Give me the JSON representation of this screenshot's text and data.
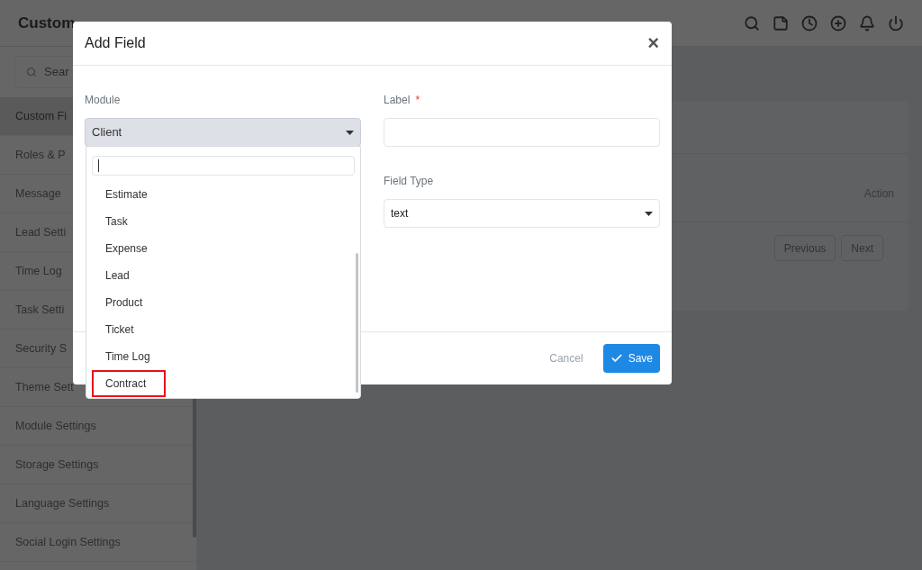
{
  "header": {
    "title": "Custom"
  },
  "sidebar": {
    "search": {
      "placeholder": "Sear"
    },
    "items": [
      {
        "label": "Custom Fi",
        "selected": true
      },
      {
        "label": "Roles & P",
        "selected": false
      },
      {
        "label": "Message",
        "selected": false
      },
      {
        "label": "Lead Setti",
        "selected": false
      },
      {
        "label": "Time Log",
        "selected": false
      },
      {
        "label": "Task Setti",
        "selected": false
      },
      {
        "label": "Security S",
        "selected": false
      },
      {
        "label": "Theme Sett",
        "selected": false
      },
      {
        "label": "Module Settings",
        "selected": false
      },
      {
        "label": "Storage Settings",
        "selected": false
      },
      {
        "label": "Language Settings",
        "selected": false
      },
      {
        "label": "Social Login Settings",
        "selected": false
      }
    ]
  },
  "card": {
    "column": "Action",
    "buttons": [
      "Previous",
      "Next"
    ]
  },
  "modal": {
    "title": "Add Field",
    "close": "×",
    "module": {
      "label": "Module",
      "value": "Client"
    },
    "label_field": {
      "label": "Label",
      "required": "*"
    },
    "field_type": {
      "label": "Field Type",
      "value": "text"
    },
    "dropdown": {
      "items": [
        {
          "label": "Estimate",
          "highlighted": false
        },
        {
          "label": "Task",
          "highlighted": false
        },
        {
          "label": "Expense",
          "highlighted": false
        },
        {
          "label": "Lead",
          "highlighted": false
        },
        {
          "label": "Product",
          "highlighted": false
        },
        {
          "label": "Ticket",
          "highlighted": false
        },
        {
          "label": "Time Log",
          "highlighted": false
        },
        {
          "label": "Contract",
          "highlighted": true
        }
      ]
    },
    "buttons": {
      "cancel": "Cancel",
      "save": "Save"
    }
  }
}
